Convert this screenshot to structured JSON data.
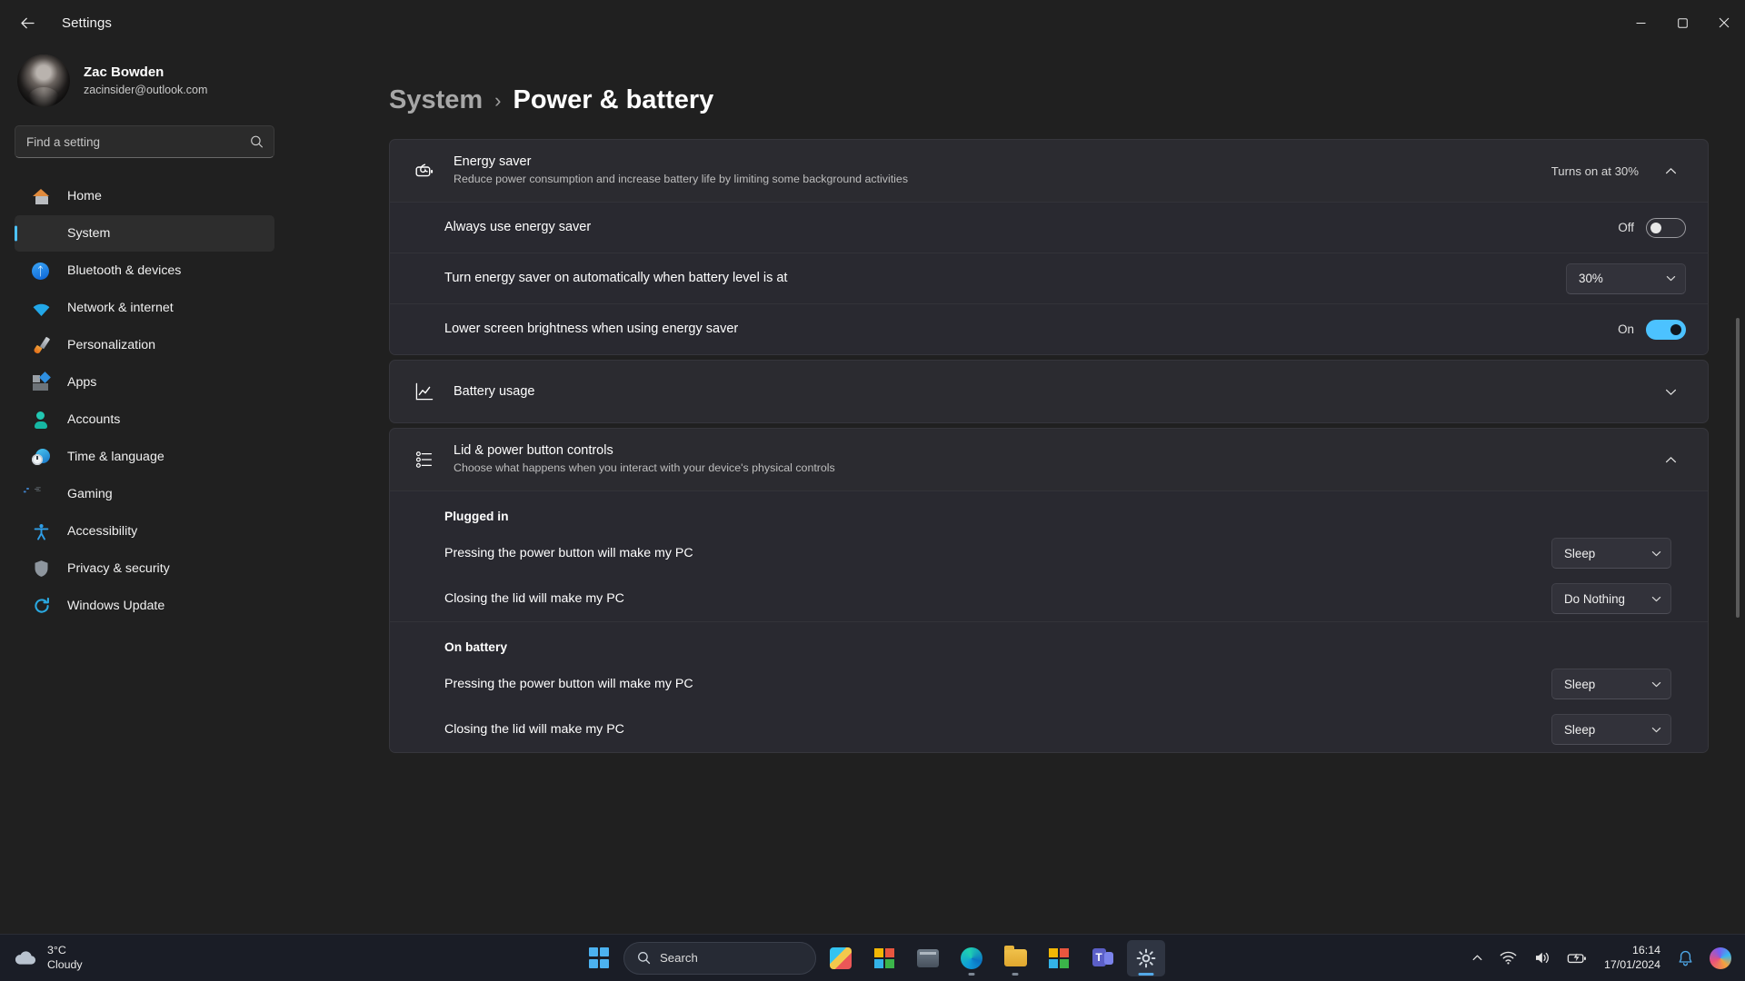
{
  "window": {
    "title": "Settings",
    "back_icon": "back-arrow-icon",
    "minimize_label": "–",
    "maximize_label": "□",
    "close_label": "✕"
  },
  "account": {
    "name": "Zac Bowden",
    "email": "zacinsider@outlook.com"
  },
  "search": {
    "placeholder": "Find a setting",
    "value": "",
    "icon": "search-icon"
  },
  "sidebar": {
    "items": [
      {
        "label": "Home",
        "icon": "home-icon",
        "active": false
      },
      {
        "label": "System",
        "icon": "system-icon",
        "active": true
      },
      {
        "label": "Bluetooth & devices",
        "icon": "bluetooth-icon",
        "active": false
      },
      {
        "label": "Network & internet",
        "icon": "wifi-icon",
        "active": false
      },
      {
        "label": "Personalization",
        "icon": "paintbrush-icon",
        "active": false
      },
      {
        "label": "Apps",
        "icon": "apps-icon",
        "active": false
      },
      {
        "label": "Accounts",
        "icon": "person-icon",
        "active": false
      },
      {
        "label": "Time & language",
        "icon": "clock-globe-icon",
        "active": false
      },
      {
        "label": "Gaming",
        "icon": "gamepad-icon",
        "active": false
      },
      {
        "label": "Accessibility",
        "icon": "accessibility-icon",
        "active": false
      },
      {
        "label": "Privacy & security",
        "icon": "shield-icon",
        "active": false
      },
      {
        "label": "Windows Update",
        "icon": "update-icon",
        "active": false
      }
    ]
  },
  "breadcrumb": {
    "parent": "System",
    "separator": "›",
    "current": "Power & battery"
  },
  "energy_saver": {
    "icon": "energy-saver-icon",
    "title": "Energy saver",
    "description": "Reduce power consumption and increase battery life by limiting some background activities",
    "status": "Turns on at 30%",
    "expand_icon": "chevron-up-icon",
    "settings": [
      {
        "label": "Always use energy saver",
        "control": "toggle",
        "state_label": "Off",
        "on": false
      },
      {
        "label": "Turn energy saver on automatically when battery level is at",
        "control": "dropdown",
        "value": "30%"
      },
      {
        "label": "Lower screen brightness when using energy saver",
        "control": "toggle",
        "state_label": "On",
        "on": true
      }
    ]
  },
  "battery_usage": {
    "icon": "chart-line-icon",
    "title": "Battery usage",
    "expand_icon": "chevron-down-icon"
  },
  "lid_power": {
    "icon": "list-settings-icon",
    "title": "Lid & power button controls",
    "description": "Choose what happens when you interact with your device's physical controls",
    "expand_icon": "chevron-up-icon",
    "groups": [
      {
        "heading": "Plugged in",
        "controls": [
          {
            "label": "Pressing the power button will make my PC",
            "value": "Sleep"
          },
          {
            "label": "Closing the lid will make my PC",
            "value": "Do Nothing"
          }
        ]
      },
      {
        "heading": "On battery",
        "controls": [
          {
            "label": "Pressing the power button will make my PC",
            "value": "Sleep"
          },
          {
            "label": "Closing the lid will make my PC",
            "value": "Sleep"
          }
        ]
      }
    ]
  },
  "taskbar": {
    "weather": {
      "temperature": "3°C",
      "condition": "Cloudy",
      "icon": "cloud-icon"
    },
    "start_icon": "windows-start-icon",
    "search": {
      "placeholder": "Search",
      "icon": "search-icon"
    },
    "apps": [
      {
        "name": "paint-3d",
        "icon": "paint3d-icon"
      },
      {
        "name": "microsoft-store-tiles",
        "icon": "store-tiles-icon"
      },
      {
        "name": "task-view",
        "icon": "task-view-icon"
      },
      {
        "name": "microsoft-edge",
        "icon": "edge-icon"
      },
      {
        "name": "file-explorer",
        "icon": "folder-icon"
      },
      {
        "name": "microsoft-store",
        "icon": "store-icon"
      },
      {
        "name": "microsoft-teams",
        "icon": "teams-icon"
      },
      {
        "name": "settings",
        "icon": "gear-icon"
      }
    ],
    "tray": {
      "overflow_icon": "chevron-up-icon",
      "wifi_icon": "wifi-icon",
      "volume_icon": "speaker-icon",
      "battery_icon": "battery-icon",
      "notification_icon": "bell-icon",
      "copilot_icon": "copilot-icon"
    },
    "clock": {
      "time": "16:14",
      "date": "17/01/2024"
    }
  }
}
